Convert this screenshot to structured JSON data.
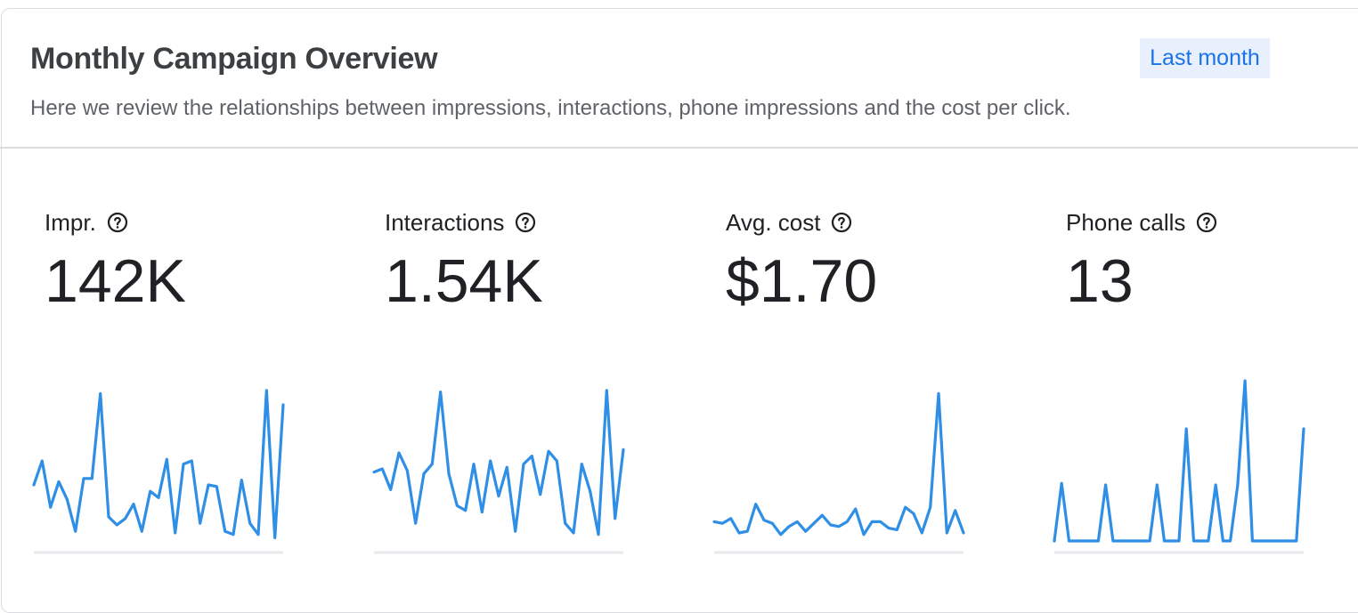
{
  "header": {
    "title": "Monthly Campaign Overview",
    "subtitle": "Here we review the relationships between impressions, interactions, phone impressions and the cost per click.",
    "date_range": "Last month"
  },
  "colors": {
    "accent": "#1a73e8",
    "line": "#2f8ee6",
    "chip_bg": "#e8f0fe",
    "baseline": "#e8eaed"
  },
  "metrics": [
    {
      "label": "Impr.",
      "value": "142K",
      "icon": "help-circle-icon"
    },
    {
      "label": "Interactions",
      "value": "1.54K",
      "icon": "help-circle-icon"
    },
    {
      "label": "Avg. cost",
      "value": "$1.70",
      "icon": "help-circle-icon"
    },
    {
      "label": "Phone calls",
      "value": "13",
      "icon": "help-circle-icon"
    }
  ],
  "chart_data": [
    {
      "type": "line",
      "metric": "Impr.",
      "values": [
        35,
        50,
        21,
        37,
        26,
        6,
        39,
        39,
        92,
        15,
        10,
        14,
        23,
        6,
        31,
        27,
        51,
        5,
        48,
        50,
        11,
        35,
        34,
        6,
        4,
        38,
        11,
        4,
        94,
        2,
        85
      ]
    },
    {
      "type": "line",
      "metric": "Interactions",
      "values": [
        43,
        45,
        32,
        55,
        44,
        11,
        42,
        48,
        93,
        42,
        22,
        19,
        48,
        18,
        50,
        28,
        46,
        6,
        48,
        53,
        29,
        56,
        50,
        11,
        5,
        48,
        31,
        4,
        94,
        14,
        57
      ]
    },
    {
      "type": "line",
      "metric": "Avg. cost",
      "values": [
        12,
        11,
        14,
        5,
        6,
        23,
        13,
        11,
        4,
        9,
        12,
        6,
        11,
        16,
        10,
        9,
        12,
        20,
        4,
        12,
        12,
        8,
        7,
        21,
        17,
        5,
        21,
        92,
        5,
        19,
        5
      ]
    },
    {
      "type": "line",
      "metric": "Phone calls",
      "values": [
        0,
        36,
        0,
        0,
        0,
        0,
        0,
        35,
        0,
        0,
        0,
        0,
        0,
        0,
        35,
        0,
        0,
        0,
        70,
        0,
        0,
        0,
        35,
        0,
        0,
        35,
        100,
        0,
        0,
        0,
        0,
        0,
        0,
        0,
        70
      ]
    }
  ]
}
